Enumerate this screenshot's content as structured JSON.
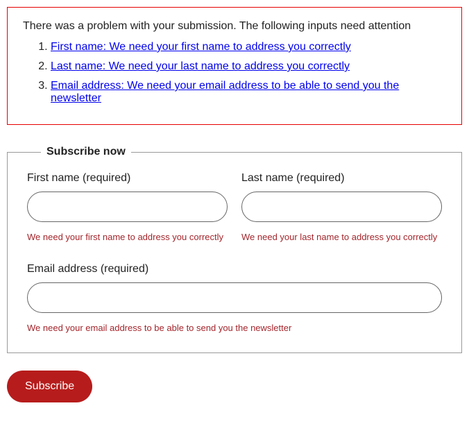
{
  "errorSummary": {
    "title": "There was a problem with your submission. The following inputs need attention",
    "items": [
      "First name: We need your first name to address you correctly",
      "Last name: We need your last name to address you correctly",
      "Email address: We need your email address to be able to send you the newsletter"
    ]
  },
  "form": {
    "legend": "Subscribe now",
    "fields": {
      "firstName": {
        "label": "First name (required)",
        "value": "",
        "error": "We need your first name to address you correctly"
      },
      "lastName": {
        "label": "Last name (required)",
        "value": "",
        "error": "We need your last name to address you correctly"
      },
      "email": {
        "label": "Email address (required)",
        "value": "",
        "error": "We need your email address to be able to send you the newsletter"
      }
    },
    "submitLabel": "Subscribe"
  }
}
